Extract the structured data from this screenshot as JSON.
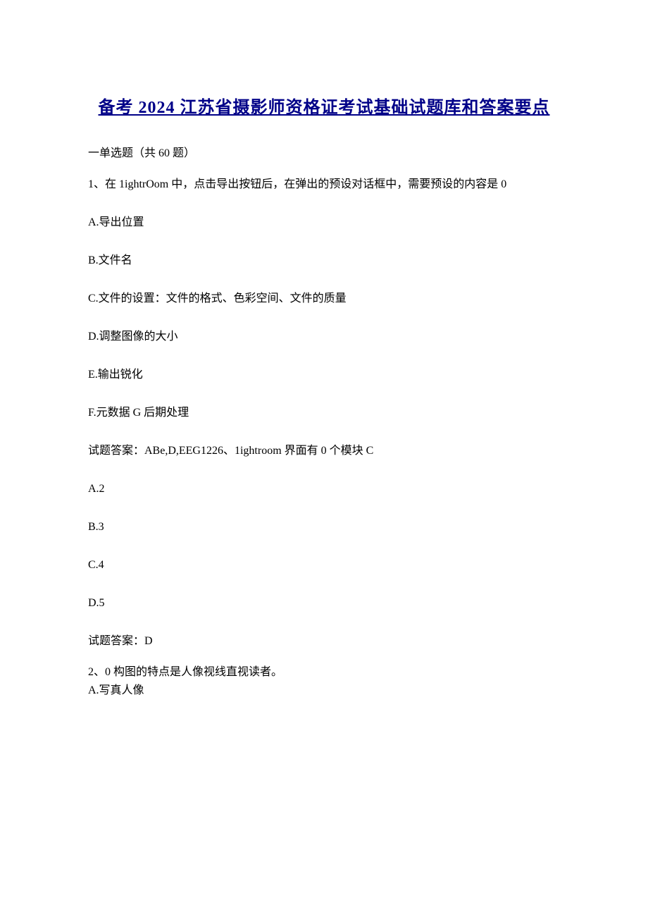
{
  "title": "备考 2024 江苏省摄影师资格证考试基础试题库和答案要点",
  "section_header": "一单选题（共 60 题）",
  "q1": {
    "text": "1、在 1ightrOom 中，点击导出按钮后，在弹出的预设对话框中，需要预设的内容是 0",
    "options": {
      "a": "A.导出位置",
      "b": "B.文件名",
      "c": "C.文件的设置：文件的格式、色彩空间、文件的质量",
      "d": "D.调整图像的大小",
      "e": "E.输出锐化",
      "f": "F.元数据 G 后期处理"
    },
    "answer_combined": "试题答案：ABe,D,EEG1226、1ightroom 界面有 0 个模块 C",
    "sub_options": {
      "a": "A.2",
      "b": "B.3",
      "c": "C.4",
      "d": "D.5"
    },
    "sub_answer": "试题答案：D"
  },
  "q2": {
    "text": "2、0 构图的特点是人像视线直视读者。",
    "option_a": "A.写真人像"
  }
}
